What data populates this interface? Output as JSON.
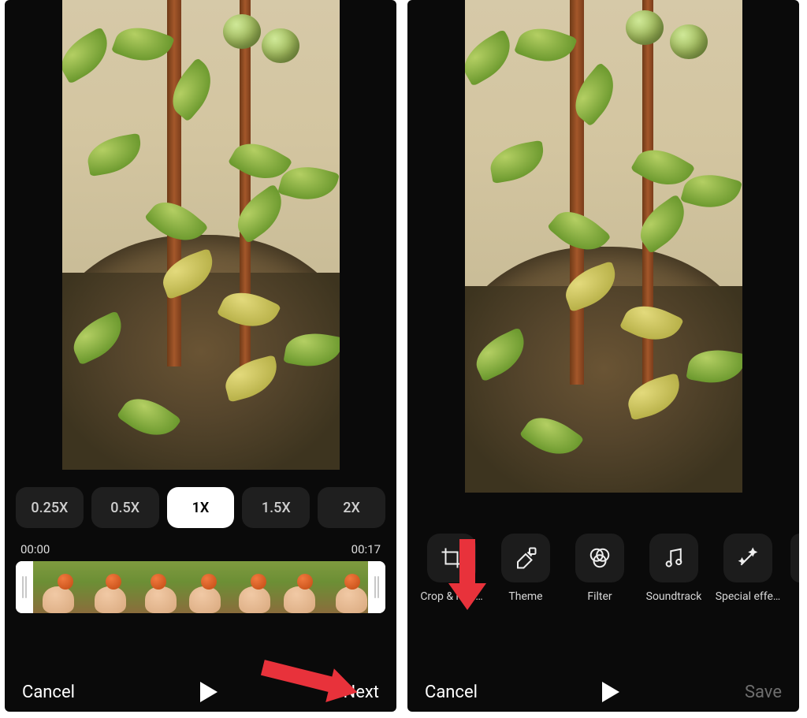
{
  "left": {
    "speeds": [
      "0.25X",
      "0.5X",
      "1X",
      "1.5X",
      "2X"
    ],
    "speed_active_index": 2,
    "time_start": "00:00",
    "time_end": "00:17",
    "cancel": "Cancel",
    "next": "Next"
  },
  "right": {
    "tools": [
      {
        "id": "crop",
        "label": "Crop & rota…"
      },
      {
        "id": "theme",
        "label": "Theme"
      },
      {
        "id": "filter",
        "label": "Filter"
      },
      {
        "id": "sound",
        "label": "Soundtrack"
      },
      {
        "id": "fx",
        "label": "Special effe…"
      }
    ],
    "cancel": "Cancel",
    "save": "Save"
  }
}
